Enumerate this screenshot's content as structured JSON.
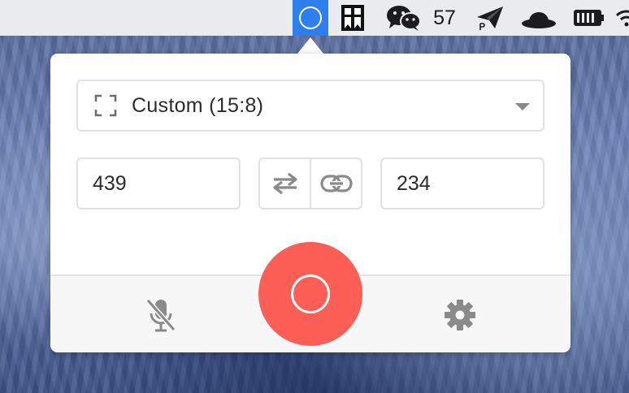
{
  "menubar": {
    "notification_count": "57",
    "icons": [
      "recorder-icon",
      "kindle-icon",
      "wechat-icon",
      "paper-plane-icon",
      "bowler-hat-icon",
      "battery-icon",
      "wifi-icon"
    ]
  },
  "recorder": {
    "preset_label": "Custom (15:8)",
    "width_value": "439",
    "height_value": "234"
  },
  "colors": {
    "menubar_active": "#2f7ef0",
    "record_button": "#fd5f57",
    "icon_gray": "#8a8a8a"
  }
}
